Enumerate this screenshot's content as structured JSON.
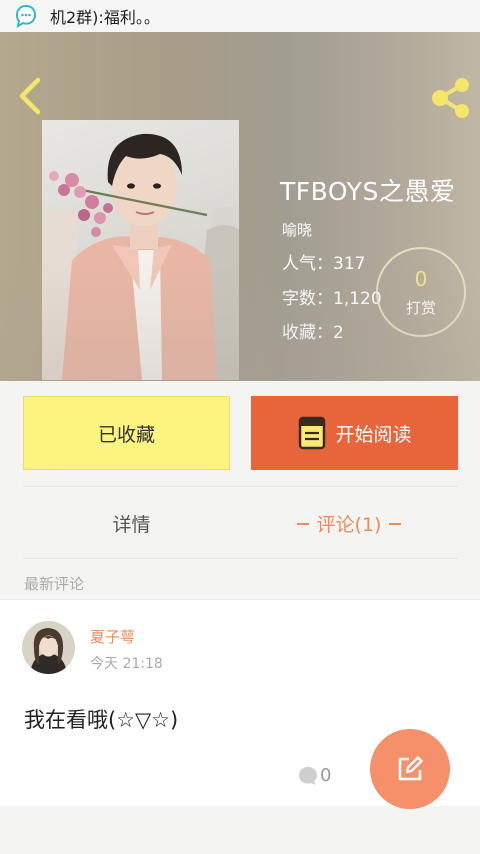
{
  "status_bar": {
    "notification_text": "机2群):福利。。",
    "notification_icon": "chat-bubble-icon"
  },
  "header": {
    "back_icon": "chevron-left-icon",
    "share_icon": "share-icon",
    "book_title": "TFBOYS之愚爱",
    "author": "喻晓",
    "popularity": "人气：317",
    "word_count": "字数：1,120",
    "favorites": "收藏：2",
    "tip": {
      "count": "0",
      "label": "打赏"
    }
  },
  "actions": {
    "favorite_label": "已收藏",
    "read_label": "开始阅读",
    "read_icon": "book-icon"
  },
  "tabs": {
    "detail": "详情",
    "comments": "评论(1)"
  },
  "comments_section": {
    "label": "最新评论",
    "items": [
      {
        "user": "夏子萼",
        "time": "今天 21:18",
        "text": "我在看哦(☆▽☆)",
        "reply_count": "0"
      }
    ]
  },
  "fab_icon": "edit-icon",
  "colors": {
    "accent": "#e8653b",
    "favorite": "#fbf47e",
    "comment_name": "#ee8a5c",
    "fab": "#f5906a"
  }
}
